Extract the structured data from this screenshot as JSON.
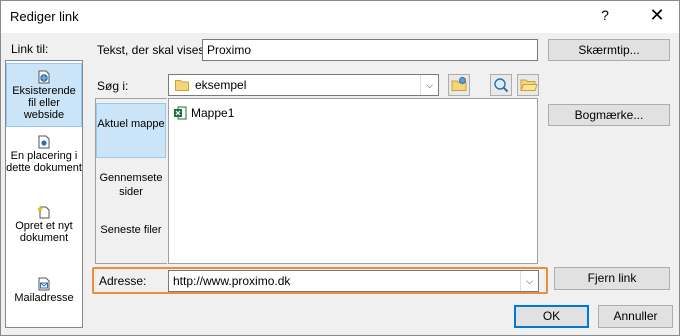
{
  "window": {
    "title": "Rediger link",
    "help_glyph": "?",
    "close_glyph": "✕"
  },
  "left": {
    "label": "Link til:",
    "items": [
      {
        "label": "Eksisterende fil eller webside",
        "icon": "existing-file-icon",
        "selected": true
      },
      {
        "label": "En placering i dette dokument",
        "icon": "place-in-document-icon"
      },
      {
        "label": "Opret et nyt dokument",
        "icon": "new-document-icon"
      },
      {
        "label": "Mailadresse",
        "icon": "email-icon"
      }
    ]
  },
  "text_to_display": {
    "label": "Tekst, der skal vises:",
    "value": "Proximo"
  },
  "screentip_button": "Skærmtip...",
  "look_in": {
    "label": "Søg i:",
    "value": "eksempel",
    "folder_icon": "folder-icon"
  },
  "toolbar_icons": [
    "browse-web-icon",
    "browse-file-icon",
    "open-folder-icon"
  ],
  "side_tabs": [
    {
      "label": "Aktuel mappe",
      "selected": true
    },
    {
      "label": "Gennemsete sider"
    },
    {
      "label": "Seneste filer"
    }
  ],
  "files": [
    {
      "name": "Mappe1",
      "icon": "excel-file-icon"
    }
  ],
  "bookmark_button": "Bogmærke...",
  "address": {
    "label": "Adresse:",
    "value": "http://www.proximo.dk"
  },
  "remove_link_button": "Fjern link",
  "ok_button": "OK",
  "cancel_button": "Annuller",
  "colors": {
    "selection": "#cce4f7",
    "highlight_border": "#f08b3a",
    "default_button": "#0078d7",
    "excel": "#1d6f42"
  }
}
